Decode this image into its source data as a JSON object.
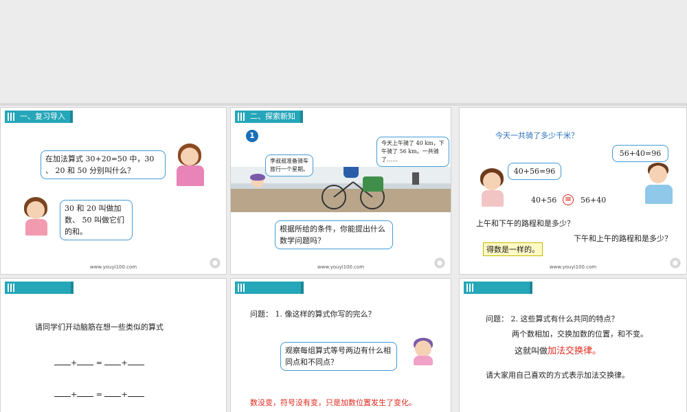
{
  "slides": [
    {
      "title": "一、复习导入",
      "bubble_teacher": "在加法算式 30+20=50 中，30 、 20 和 50 分别叫什么？",
      "bubble_girl": "30 和 20 叫做加数、 50 叫做它们的和。",
      "footer": "www.youyi100.com"
    },
    {
      "title": "二、探索新知",
      "badge": "1",
      "bubble_cyclist": "今天上午骑了 40 km，下午骑了 56 km。一共骑了……",
      "bubble_fairy": "李叔叔准备骑车旅行一个星期。",
      "bubble_question": "根据所给的条件，你能提出什么数学问题吗？",
      "footer": "www.youyi100.com"
    },
    {
      "question": "今天一共骑了多少千米？",
      "bubble_left": "40+56=96",
      "bubble_right": "56+40=96",
      "expr_left": "40+56",
      "equals": "=",
      "expr_right": "56+40",
      "line1": "上午和下午的路程和是多少？",
      "line2": "下午和上午的路程和是多少？",
      "highlight": "得数是一样的。",
      "footer": "www.youyi100.com"
    },
    {
      "prompt": "请同学们开动脑筋在想一些类似的算式",
      "row1": [
        "+",
        "=",
        "+"
      ],
      "row2": [
        "+",
        "=",
        "+"
      ]
    },
    {
      "question_label": "问题：",
      "question_num": "1.",
      "question_text": "像这样的算式你写的完么？",
      "bubble": "观察每组算式等号两边有什么相同点和不同点？",
      "conclusion": "数没变，符号没有变，只是加数位置发生了变化。"
    },
    {
      "question_label": "问题：",
      "question_num": "2.",
      "question_text": "这些算式有什么共同的特点？",
      "line1": "两个数相加，交换加数的位置，和不变。",
      "line2_prefix": "这就叫做",
      "line2_term": "加法交换律。",
      "line3": "请大家用自己喜欢的方式表示加法交换律。"
    }
  ]
}
